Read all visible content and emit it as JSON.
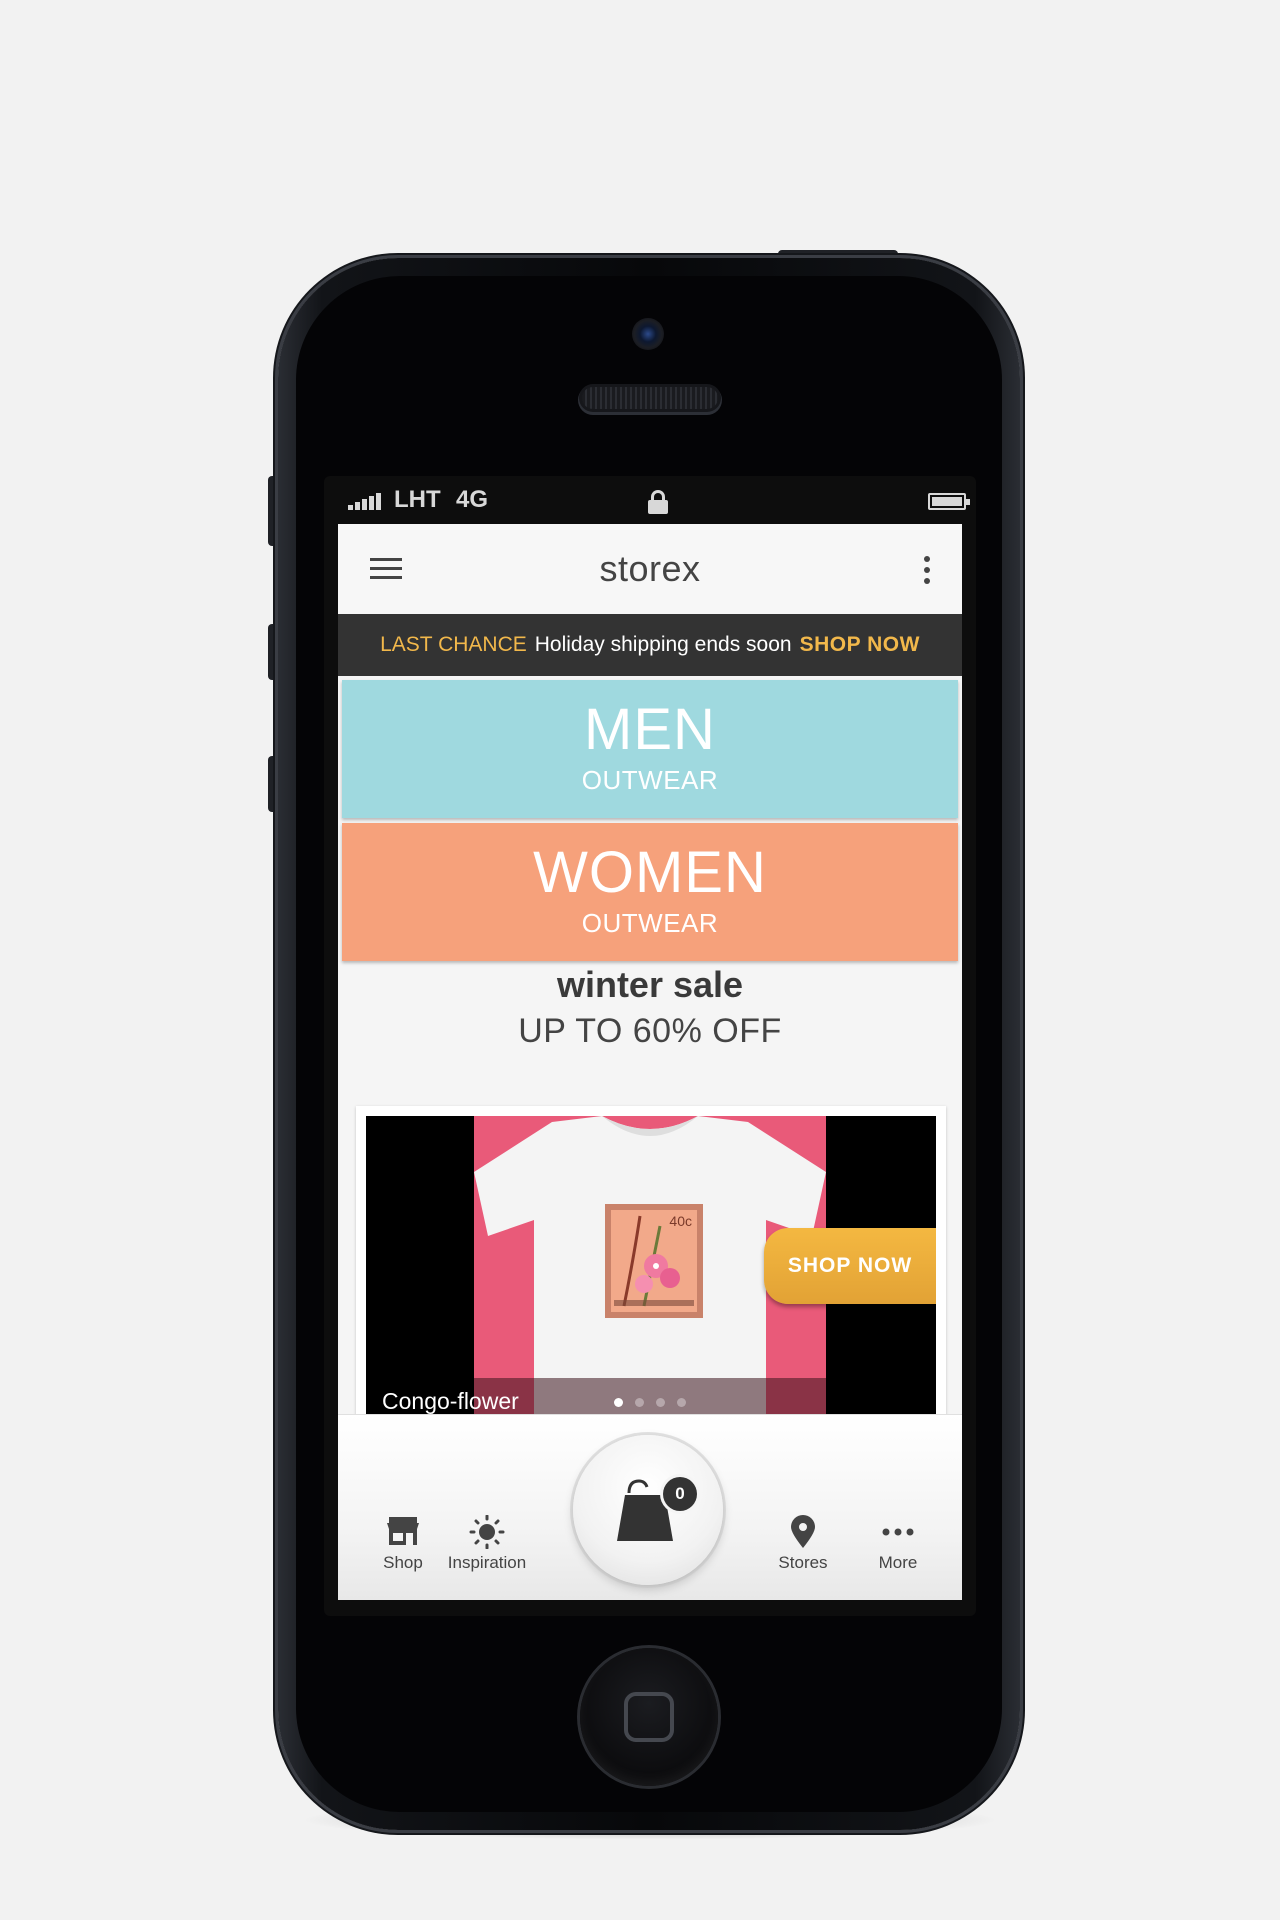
{
  "status_bar": {
    "carrier": "LHT",
    "network": "4G"
  },
  "app": {
    "title": "storex"
  },
  "promo": {
    "label": "LAST CHANCE",
    "message": "Holiday shipping ends soon",
    "cta": "SHOP NOW"
  },
  "categories": [
    {
      "title": "MEN",
      "subtitle": "OUTWEAR",
      "color": "#9fd9df"
    },
    {
      "title": "WOMEN",
      "subtitle": "OUTWEAR",
      "color": "#f6a17b"
    }
  ],
  "sale": {
    "title": "winter sale",
    "subtitle": "UP TO 60% OFF"
  },
  "carousel": {
    "caption": "Congo-flower",
    "cta": "SHOP NOW",
    "slide_count": 4,
    "active_slide": 1,
    "stamp_value": "40c"
  },
  "bottom_nav": {
    "items": [
      {
        "label": "Shop",
        "icon": "store-icon"
      },
      {
        "label": "Inspiration",
        "icon": "sun-icon"
      },
      {
        "label": "Stores",
        "icon": "location-pin-icon"
      },
      {
        "label": "More",
        "icon": "more-dots-icon"
      }
    ],
    "cart_count": "0"
  },
  "colors": {
    "accent": "#f2b84b",
    "promo_bg": "#333333",
    "product_bg": "#e95a79"
  }
}
